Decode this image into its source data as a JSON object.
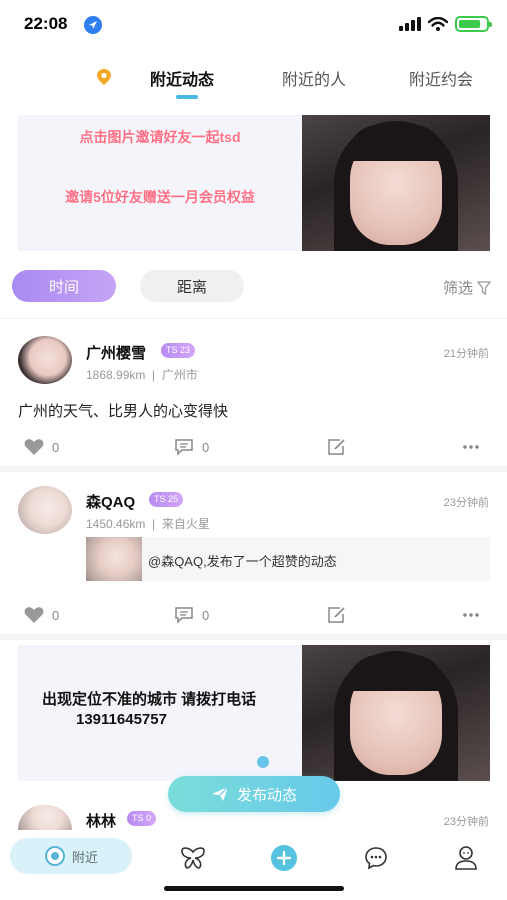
{
  "status_bar": {
    "time": "22:08",
    "location_icon": "location-arrow-icon",
    "battery_level": 0.8
  },
  "top_tabs": {
    "location_icon": "pin-icon",
    "tabs": [
      {
        "label": "附近动态",
        "active": true
      },
      {
        "label": "附近的人",
        "active": false
      },
      {
        "label": "附近约会",
        "active": false
      }
    ]
  },
  "banner_top": {
    "line1": "点击图片邀请好友一起tsd",
    "line2": "邀请5位好友赠送一月会员权益"
  },
  "sort": {
    "time_label": "时间",
    "distance_label": "距离",
    "filter_label": "筛选"
  },
  "posts": [
    {
      "username": "广州樱雪",
      "badge": "TS 23",
      "distance": "1868.99km",
      "location": "广州市",
      "time": "21分钟前",
      "content": "广州的天气、比男人的心变得快",
      "likes": "0",
      "comments": "0"
    },
    {
      "username": "森QAQ",
      "badge": "TS 25",
      "distance": "1450.46km",
      "location": "来自火星",
      "time": "23分钟前",
      "share_text": "@森QAQ,发布了一个超赞的动态",
      "likes": "0",
      "comments": "0"
    },
    {
      "username": "林林",
      "badge": "TS 0",
      "time": "23分钟前"
    }
  ],
  "banner_bottom": {
    "line1": "出现定位不准的城市 请拨打电话",
    "line2": "13911645757"
  },
  "publish_button": {
    "label": "发布动态"
  },
  "bottom_nav": {
    "home_label": "附近"
  },
  "colors": {
    "accent_blue": "#49b9e6",
    "badge_purple": "#b78bf3",
    "banner_pink": "#ff6f86"
  }
}
